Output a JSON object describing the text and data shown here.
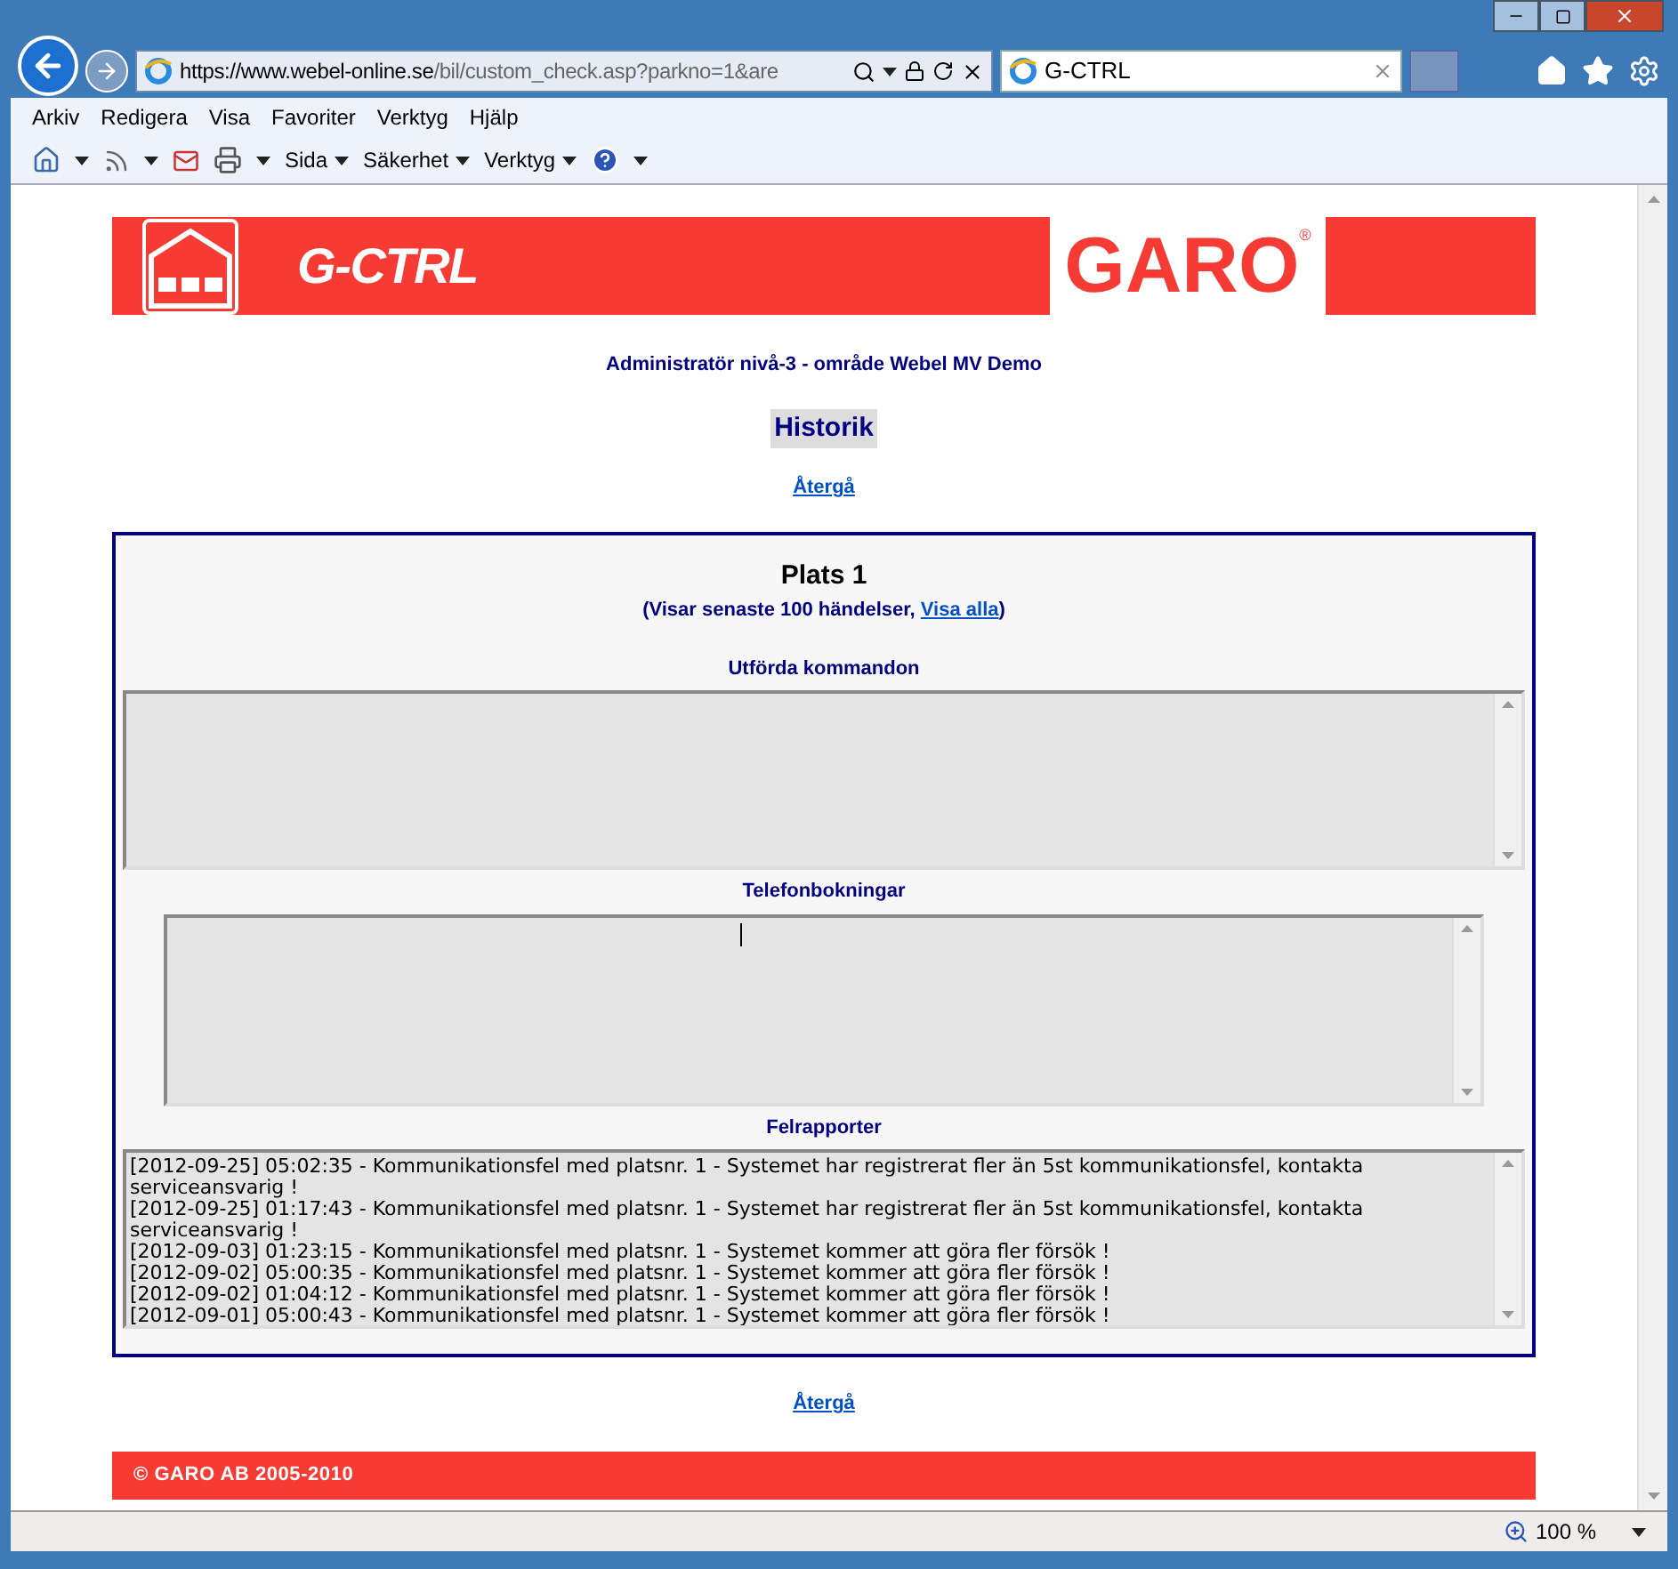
{
  "browser": {
    "url_host": "https://www.webel-online.se",
    "url_path": "/bil/custom_check.asp?parkno=1&are",
    "tab_title": "G-CTRL"
  },
  "menu": [
    "Arkiv",
    "Redigera",
    "Visa",
    "Favoriter",
    "Verktyg",
    "Hjälp"
  ],
  "command_menus": [
    "Sida",
    "Säkerhet",
    "Verktyg"
  ],
  "banner": {
    "product": "G-CTRL",
    "brand": "GARO",
    "registered": "®"
  },
  "user_line": "Administratör nivå-3  - område Webel MV Demo",
  "heading": "Historik",
  "back_link_top": "Återgå",
  "panel": {
    "title": "Plats 1",
    "subtitle_before": "(Visar senaste 100 händelser, ",
    "subtitle_link": "Visa alla",
    "subtitle_after": ")",
    "commands_label": "Utförda kommandon",
    "bookings_label": "Telefonbokningar",
    "errors_label": "Felrapporter",
    "errors": [
      "[2012-09-25] 05:02:35 - Kommunikationsfel med platsnr. 1 - Systemet har registrerat fler än 5st kommunikationsfel, kontakta serviceansvarig !",
      "[2012-09-25] 01:17:43 - Kommunikationsfel med platsnr. 1 - Systemet har registrerat fler än 5st kommunikationsfel, kontakta serviceansvarig !",
      "[2012-09-03] 01:23:15 - Kommunikationsfel med platsnr. 1 - Systemet kommer att göra fler försök !",
      "[2012-09-02] 05:00:35 - Kommunikationsfel med platsnr. 1 - Systemet kommer att göra fler försök !",
      "[2012-09-02] 01:04:12 - Kommunikationsfel med platsnr. 1 - Systemet kommer att göra fler försök !",
      "[2012-09-01] 05:00:43 - Kommunikationsfel med platsnr. 1 - Systemet kommer att göra fler försök !"
    ]
  },
  "back_link_bottom": "Återgå",
  "footer": "© GARO AB 2005-2010",
  "status": {
    "zoom": "100 %"
  }
}
